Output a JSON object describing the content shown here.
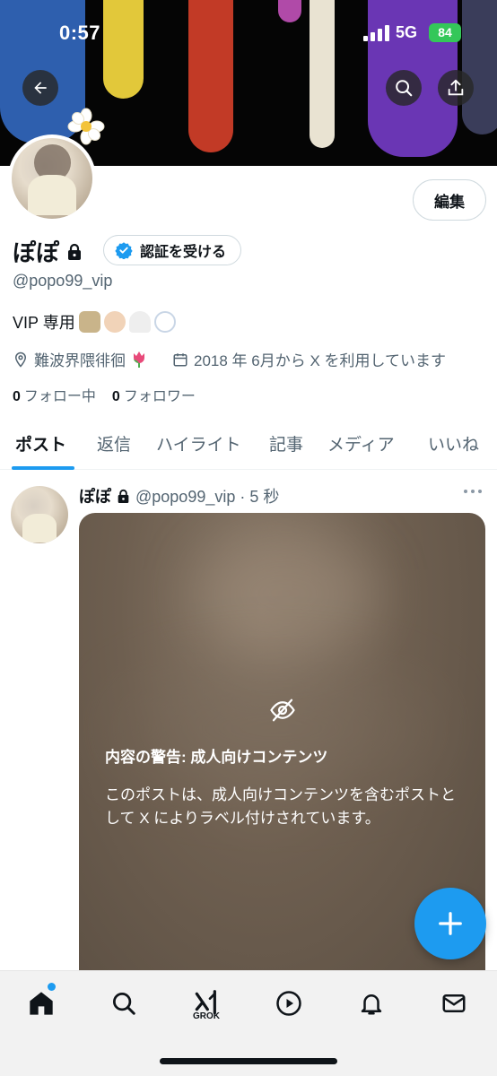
{
  "status_bar": {
    "time": "0:57",
    "network": "5G",
    "battery": "84"
  },
  "colors": {
    "accent": "#1d9bf0",
    "battery": "#34c759",
    "text_secondary": "#536471"
  },
  "header_icons": [
    "back-arrow-icon",
    "search-icon",
    "share-icon"
  ],
  "profile": {
    "display_name": "ぽぽ",
    "verify_label": "認証を受ける",
    "handle": "@popo99_vip",
    "bio": "VIP 専用",
    "location": "難波界隈徘徊",
    "joined": "2018 年 6月から X を利用しています",
    "edit_label": "編集",
    "following_count": "0",
    "following_label": "フォロー中",
    "followers_count": "0",
    "followers_label": "フォロワー"
  },
  "tabs": [
    {
      "label": "ポスト",
      "active": true
    },
    {
      "label": "返信",
      "active": false
    },
    {
      "label": "ハイライト",
      "active": false
    },
    {
      "label": "記事",
      "active": false
    },
    {
      "label": "メディア",
      "active": false
    },
    {
      "label": "いいね",
      "active": false
    }
  ],
  "post": {
    "name": "ぽぽ",
    "handle_time": "@popo99_vip · 5 秒",
    "warning_title": "内容の警告: 成人向けコンテンツ",
    "warning_text": "このポストは、成人向けコンテンツを含むポストとして X によりラベル付けされています。"
  },
  "bottom_nav": {
    "items": [
      "home-icon",
      "search-icon",
      "grok-icon",
      "video-icon",
      "notifications-icon",
      "messages-icon"
    ],
    "grok_label": "GROK"
  }
}
